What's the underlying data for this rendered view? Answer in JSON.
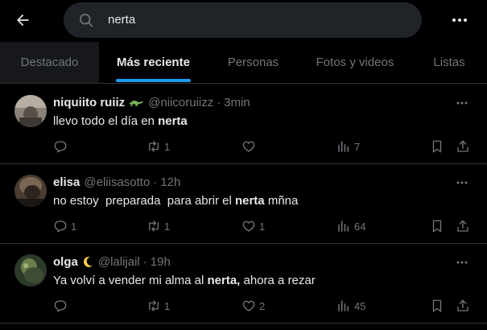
{
  "search": {
    "query": "nerta"
  },
  "tabs": [
    {
      "label": "Destacado"
    },
    {
      "label": "Más reciente"
    },
    {
      "label": "Personas"
    },
    {
      "label": "Fotos y videos"
    },
    {
      "label": "Listas"
    }
  ],
  "posts": [
    {
      "name": "niquiito ruiiz",
      "handle": "@niicoruiizz",
      "time": "3min",
      "text_before": "llevo todo el día en ",
      "text_bold": "nerta",
      "text_after": "",
      "replies": "",
      "reposts": "1",
      "likes": "",
      "views": "7",
      "emoji": "lizard-emoji"
    },
    {
      "name": "elisa",
      "handle": "@eliisasotto",
      "time": "12h",
      "text_before": "no estoy  preparada  para abrir el ",
      "text_bold": "nerta",
      "text_after": " mñna",
      "replies": "1",
      "reposts": "1",
      "likes": "1",
      "views": "64",
      "emoji": ""
    },
    {
      "name": "olga",
      "handle": "@lalijail",
      "time": "19h",
      "text_before": "Ya volví a vender mi alma al ",
      "text_bold": "nerta,",
      "text_after": " ahora a rezar",
      "replies": "",
      "reposts": "1",
      "likes": "2",
      "views": "45",
      "emoji": "crescent-moon-emoji"
    }
  ],
  "colors": {
    "background": "#000000",
    "text": "#e7e9ea",
    "secondary": "#71767b",
    "accent": "#1d9bf0",
    "border": "#2f3336",
    "search_bg": "#202327"
  }
}
